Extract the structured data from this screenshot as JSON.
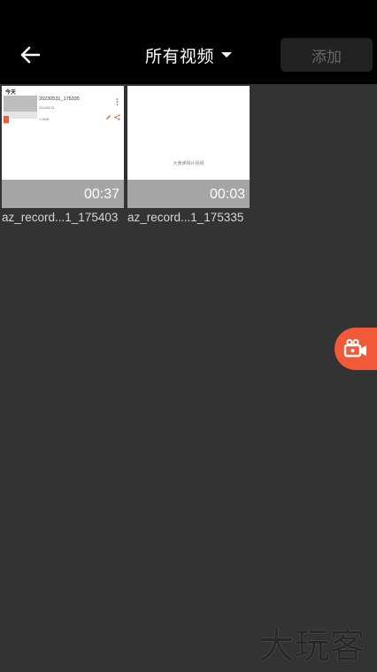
{
  "header": {
    "title": "所有视频",
    "add_label": "添加"
  },
  "videos": [
    {
      "duration": "00:37",
      "filename": "az_record...1_175403",
      "thumb": {
        "today": "今天",
        "name": "20230531_175335",
        "meta": "2023/5/31",
        "size": "1.5MB"
      }
    },
    {
      "duration": "00:03",
      "filename": "az_record...1_175335",
      "thumb": {
        "center_text": "大黄蜂相片视频"
      }
    }
  ],
  "watermark": "大玩客",
  "colors": {
    "accent": "#f15a38",
    "background": "#333333",
    "topbar": "#000000"
  },
  "icons": {
    "back": "arrow-left-icon",
    "dropdown": "caret-down-icon",
    "record": "video-camera-icon"
  }
}
